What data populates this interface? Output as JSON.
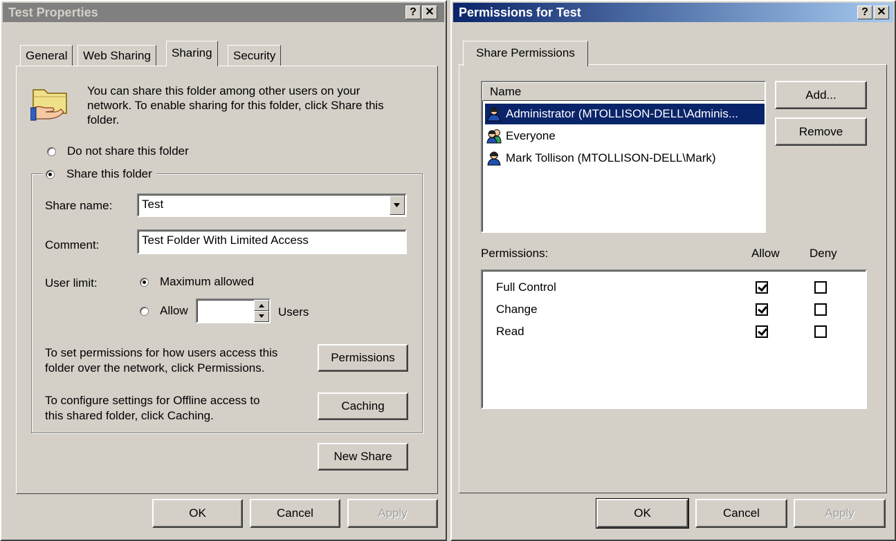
{
  "props_window": {
    "title": "Test Properties",
    "help_btn": "?",
    "close_btn": "✕",
    "tabs": [
      {
        "label": "General"
      },
      {
        "label": "Web Sharing"
      },
      {
        "label": "Sharing"
      },
      {
        "label": "Security"
      }
    ],
    "intro_line1": "You can share this folder among other users on your",
    "intro_line2": "network.  To enable sharing for this folder, click Share this",
    "intro_line3": "folder.",
    "do_not_share_label": "Do not share this folder",
    "share_label": "Share this folder",
    "share_name_label": "Share name:",
    "share_name_value": "Test",
    "comment_label": "Comment:",
    "comment_value": "Test Folder With Limited Access",
    "user_limit_label": "User limit:",
    "max_allowed_label": "Maximum allowed",
    "allow_label": "Allow",
    "users_label": "Users",
    "perm_text_line1": "To set permissions for how users access this",
    "perm_text_line2": "folder over the network, click Permissions.",
    "permissions_button": "Permissions",
    "caching_text_line1": "To configure settings for Offline access to",
    "caching_text_line2": "this shared folder, click Caching.",
    "caching_button": "Caching",
    "new_share_button": "New Share",
    "ok_button": "OK",
    "cancel_button": "Cancel",
    "apply_button": "Apply"
  },
  "perm_window": {
    "title": "Permissions for Test",
    "help_btn": "?",
    "close_btn": "✕",
    "tab_label": "Share Permissions",
    "name_header": "Name",
    "users": [
      {
        "name": "Administrator (MTOLLISON-DELL\\Adminis..."
      },
      {
        "name": "Everyone"
      },
      {
        "name": "Mark Tollison (MTOLLISON-DELL\\Mark)"
      }
    ],
    "add_button": "Add...",
    "remove_button": "Remove",
    "permissions_label": "Permissions:",
    "allow_header": "Allow",
    "deny_header": "Deny",
    "permissions": [
      {
        "name": "Full Control",
        "allow": true,
        "deny": false
      },
      {
        "name": "Change",
        "allow": true,
        "deny": false
      },
      {
        "name": "Read",
        "allow": true,
        "deny": false
      }
    ],
    "ok_button": "OK",
    "cancel_button": "Cancel",
    "apply_button": "Apply"
  },
  "colors": {
    "face": "#d4d0c8",
    "active_title_start": "#0a246a",
    "active_title_end": "#a6caf0",
    "inactive_title": "#808080",
    "selection": "#0a246a"
  }
}
